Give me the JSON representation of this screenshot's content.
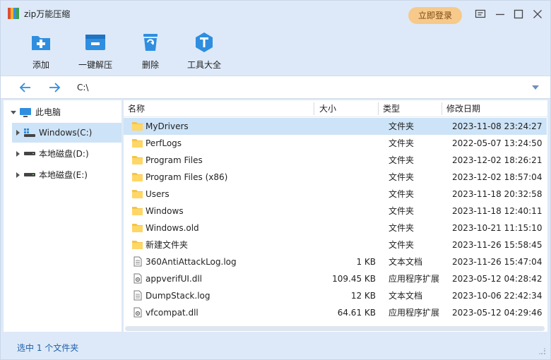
{
  "app": {
    "title": "zip万能压缩",
    "logo_icon": "zip-app-logo-icon",
    "login_label": "立即登录",
    "accent": "#2f8ee0",
    "login_color": "#f7c98a"
  },
  "window_controls": [
    "feedback-icon",
    "minimize-icon",
    "maximize-icon",
    "close-icon"
  ],
  "toolbar": {
    "items": [
      {
        "label": "添加",
        "icon": "add-folder-icon"
      },
      {
        "label": "一键解压",
        "icon": "extract-icon"
      },
      {
        "label": "删除",
        "icon": "trash-icon"
      },
      {
        "label": "工具大全",
        "icon": "tools-icon"
      }
    ]
  },
  "address": {
    "path": "C:\\",
    "back_icon": "back-arrow-icon",
    "forward_icon": "forward-arrow-icon",
    "dropdown_icon": "chevron-down-icon"
  },
  "tree": {
    "root": {
      "label": "此电脑",
      "icon": "computer-icon"
    },
    "drives": [
      {
        "label": "Windows(C:)",
        "icon": "system-drive-icon"
      },
      {
        "label": "本地磁盘(D:)",
        "icon": "drive-icon"
      },
      {
        "label": "本地磁盘(E:)",
        "icon": "drive-icon"
      }
    ]
  },
  "list": {
    "columns": [
      "名称",
      "大小",
      "类型",
      "修改日期"
    ],
    "rows": [
      {
        "name": "MyDrivers",
        "size": "",
        "type": "文件夹",
        "date": "2023-11-08 23:24:27",
        "kind": "folder"
      },
      {
        "name": "PerfLogs",
        "size": "",
        "type": "文件夹",
        "date": "2022-05-07 13:24:50",
        "kind": "folder"
      },
      {
        "name": "Program Files",
        "size": "",
        "type": "文件夹",
        "date": "2023-12-02 18:26:21",
        "kind": "folder"
      },
      {
        "name": "Program Files (x86)",
        "size": "",
        "type": "文件夹",
        "date": "2023-12-02 18:57:04",
        "kind": "folder"
      },
      {
        "name": "Users",
        "size": "",
        "type": "文件夹",
        "date": "2023-11-18 20:32:58",
        "kind": "folder"
      },
      {
        "name": "Windows",
        "size": "",
        "type": "文件夹",
        "date": "2023-11-18 12:40:11",
        "kind": "folder"
      },
      {
        "name": "Windows.old",
        "size": "",
        "type": "文件夹",
        "date": "2023-10-21 11:15:10",
        "kind": "folder"
      },
      {
        "name": "新建文件夹",
        "size": "",
        "type": "文件夹",
        "date": "2023-11-26 15:58:45",
        "kind": "folder"
      },
      {
        "name": "360AntiAttackLog.log",
        "size": "1 KB",
        "type": "文本文档",
        "date": "2023-11-26 15:47:04",
        "kind": "text"
      },
      {
        "name": "appverifUI.dll",
        "size": "109.45 KB",
        "type": "应用程序扩展",
        "date": "2023-05-12 04:28:42",
        "kind": "dll"
      },
      {
        "name": "DumpStack.log",
        "size": "12 KB",
        "type": "文本文档",
        "date": "2023-10-06 22:42:34",
        "kind": "text"
      },
      {
        "name": "vfcompat.dll",
        "size": "64.61 KB",
        "type": "应用程序扩展",
        "date": "2023-05-12 04:29:46",
        "kind": "dll"
      }
    ]
  },
  "status": {
    "text": "选中 1 个文件夹"
  }
}
